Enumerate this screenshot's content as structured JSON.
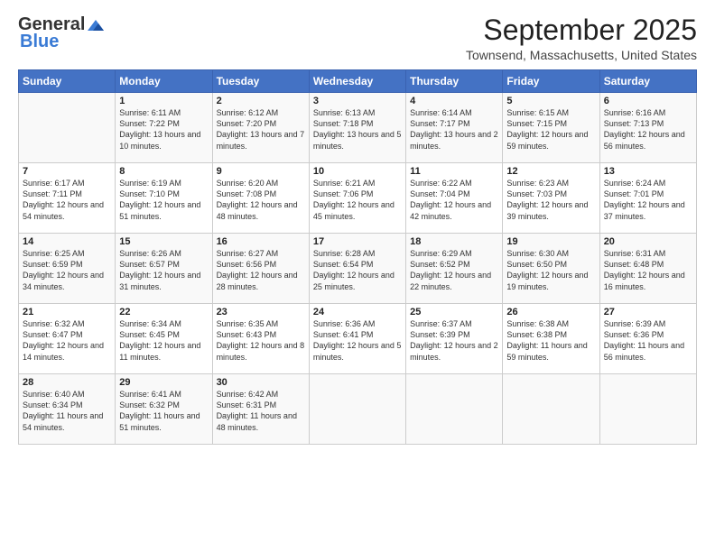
{
  "header": {
    "logo_general": "General",
    "logo_blue": "Blue",
    "month_title": "September 2025",
    "location": "Townsend, Massachusetts, United States"
  },
  "days_of_week": [
    "Sunday",
    "Monday",
    "Tuesday",
    "Wednesday",
    "Thursday",
    "Friday",
    "Saturday"
  ],
  "weeks": [
    [
      {
        "day": "",
        "sunrise": "",
        "sunset": "",
        "daylight": ""
      },
      {
        "day": "1",
        "sunrise": "Sunrise: 6:11 AM",
        "sunset": "Sunset: 7:22 PM",
        "daylight": "Daylight: 13 hours and 10 minutes."
      },
      {
        "day": "2",
        "sunrise": "Sunrise: 6:12 AM",
        "sunset": "Sunset: 7:20 PM",
        "daylight": "Daylight: 13 hours and 7 minutes."
      },
      {
        "day": "3",
        "sunrise": "Sunrise: 6:13 AM",
        "sunset": "Sunset: 7:18 PM",
        "daylight": "Daylight: 13 hours and 5 minutes."
      },
      {
        "day": "4",
        "sunrise": "Sunrise: 6:14 AM",
        "sunset": "Sunset: 7:17 PM",
        "daylight": "Daylight: 13 hours and 2 minutes."
      },
      {
        "day": "5",
        "sunrise": "Sunrise: 6:15 AM",
        "sunset": "Sunset: 7:15 PM",
        "daylight": "Daylight: 12 hours and 59 minutes."
      },
      {
        "day": "6",
        "sunrise": "Sunrise: 6:16 AM",
        "sunset": "Sunset: 7:13 PM",
        "daylight": "Daylight: 12 hours and 56 minutes."
      }
    ],
    [
      {
        "day": "7",
        "sunrise": "Sunrise: 6:17 AM",
        "sunset": "Sunset: 7:11 PM",
        "daylight": "Daylight: 12 hours and 54 minutes."
      },
      {
        "day": "8",
        "sunrise": "Sunrise: 6:19 AM",
        "sunset": "Sunset: 7:10 PM",
        "daylight": "Daylight: 12 hours and 51 minutes."
      },
      {
        "day": "9",
        "sunrise": "Sunrise: 6:20 AM",
        "sunset": "Sunset: 7:08 PM",
        "daylight": "Daylight: 12 hours and 48 minutes."
      },
      {
        "day": "10",
        "sunrise": "Sunrise: 6:21 AM",
        "sunset": "Sunset: 7:06 PM",
        "daylight": "Daylight: 12 hours and 45 minutes."
      },
      {
        "day": "11",
        "sunrise": "Sunrise: 6:22 AM",
        "sunset": "Sunset: 7:04 PM",
        "daylight": "Daylight: 12 hours and 42 minutes."
      },
      {
        "day": "12",
        "sunrise": "Sunrise: 6:23 AM",
        "sunset": "Sunset: 7:03 PM",
        "daylight": "Daylight: 12 hours and 39 minutes."
      },
      {
        "day": "13",
        "sunrise": "Sunrise: 6:24 AM",
        "sunset": "Sunset: 7:01 PM",
        "daylight": "Daylight: 12 hours and 37 minutes."
      }
    ],
    [
      {
        "day": "14",
        "sunrise": "Sunrise: 6:25 AM",
        "sunset": "Sunset: 6:59 PM",
        "daylight": "Daylight: 12 hours and 34 minutes."
      },
      {
        "day": "15",
        "sunrise": "Sunrise: 6:26 AM",
        "sunset": "Sunset: 6:57 PM",
        "daylight": "Daylight: 12 hours and 31 minutes."
      },
      {
        "day": "16",
        "sunrise": "Sunrise: 6:27 AM",
        "sunset": "Sunset: 6:56 PM",
        "daylight": "Daylight: 12 hours and 28 minutes."
      },
      {
        "day": "17",
        "sunrise": "Sunrise: 6:28 AM",
        "sunset": "Sunset: 6:54 PM",
        "daylight": "Daylight: 12 hours and 25 minutes."
      },
      {
        "day": "18",
        "sunrise": "Sunrise: 6:29 AM",
        "sunset": "Sunset: 6:52 PM",
        "daylight": "Daylight: 12 hours and 22 minutes."
      },
      {
        "day": "19",
        "sunrise": "Sunrise: 6:30 AM",
        "sunset": "Sunset: 6:50 PM",
        "daylight": "Daylight: 12 hours and 19 minutes."
      },
      {
        "day": "20",
        "sunrise": "Sunrise: 6:31 AM",
        "sunset": "Sunset: 6:48 PM",
        "daylight": "Daylight: 12 hours and 16 minutes."
      }
    ],
    [
      {
        "day": "21",
        "sunrise": "Sunrise: 6:32 AM",
        "sunset": "Sunset: 6:47 PM",
        "daylight": "Daylight: 12 hours and 14 minutes."
      },
      {
        "day": "22",
        "sunrise": "Sunrise: 6:34 AM",
        "sunset": "Sunset: 6:45 PM",
        "daylight": "Daylight: 12 hours and 11 minutes."
      },
      {
        "day": "23",
        "sunrise": "Sunrise: 6:35 AM",
        "sunset": "Sunset: 6:43 PM",
        "daylight": "Daylight: 12 hours and 8 minutes."
      },
      {
        "day": "24",
        "sunrise": "Sunrise: 6:36 AM",
        "sunset": "Sunset: 6:41 PM",
        "daylight": "Daylight: 12 hours and 5 minutes."
      },
      {
        "day": "25",
        "sunrise": "Sunrise: 6:37 AM",
        "sunset": "Sunset: 6:39 PM",
        "daylight": "Daylight: 12 hours and 2 minutes."
      },
      {
        "day": "26",
        "sunrise": "Sunrise: 6:38 AM",
        "sunset": "Sunset: 6:38 PM",
        "daylight": "Daylight: 11 hours and 59 minutes."
      },
      {
        "day": "27",
        "sunrise": "Sunrise: 6:39 AM",
        "sunset": "Sunset: 6:36 PM",
        "daylight": "Daylight: 11 hours and 56 minutes."
      }
    ],
    [
      {
        "day": "28",
        "sunrise": "Sunrise: 6:40 AM",
        "sunset": "Sunset: 6:34 PM",
        "daylight": "Daylight: 11 hours and 54 minutes."
      },
      {
        "day": "29",
        "sunrise": "Sunrise: 6:41 AM",
        "sunset": "Sunset: 6:32 PM",
        "daylight": "Daylight: 11 hours and 51 minutes."
      },
      {
        "day": "30",
        "sunrise": "Sunrise: 6:42 AM",
        "sunset": "Sunset: 6:31 PM",
        "daylight": "Daylight: 11 hours and 48 minutes."
      },
      {
        "day": "",
        "sunrise": "",
        "sunset": "",
        "daylight": ""
      },
      {
        "day": "",
        "sunrise": "",
        "sunset": "",
        "daylight": ""
      },
      {
        "day": "",
        "sunrise": "",
        "sunset": "",
        "daylight": ""
      },
      {
        "day": "",
        "sunrise": "",
        "sunset": "",
        "daylight": ""
      }
    ]
  ]
}
